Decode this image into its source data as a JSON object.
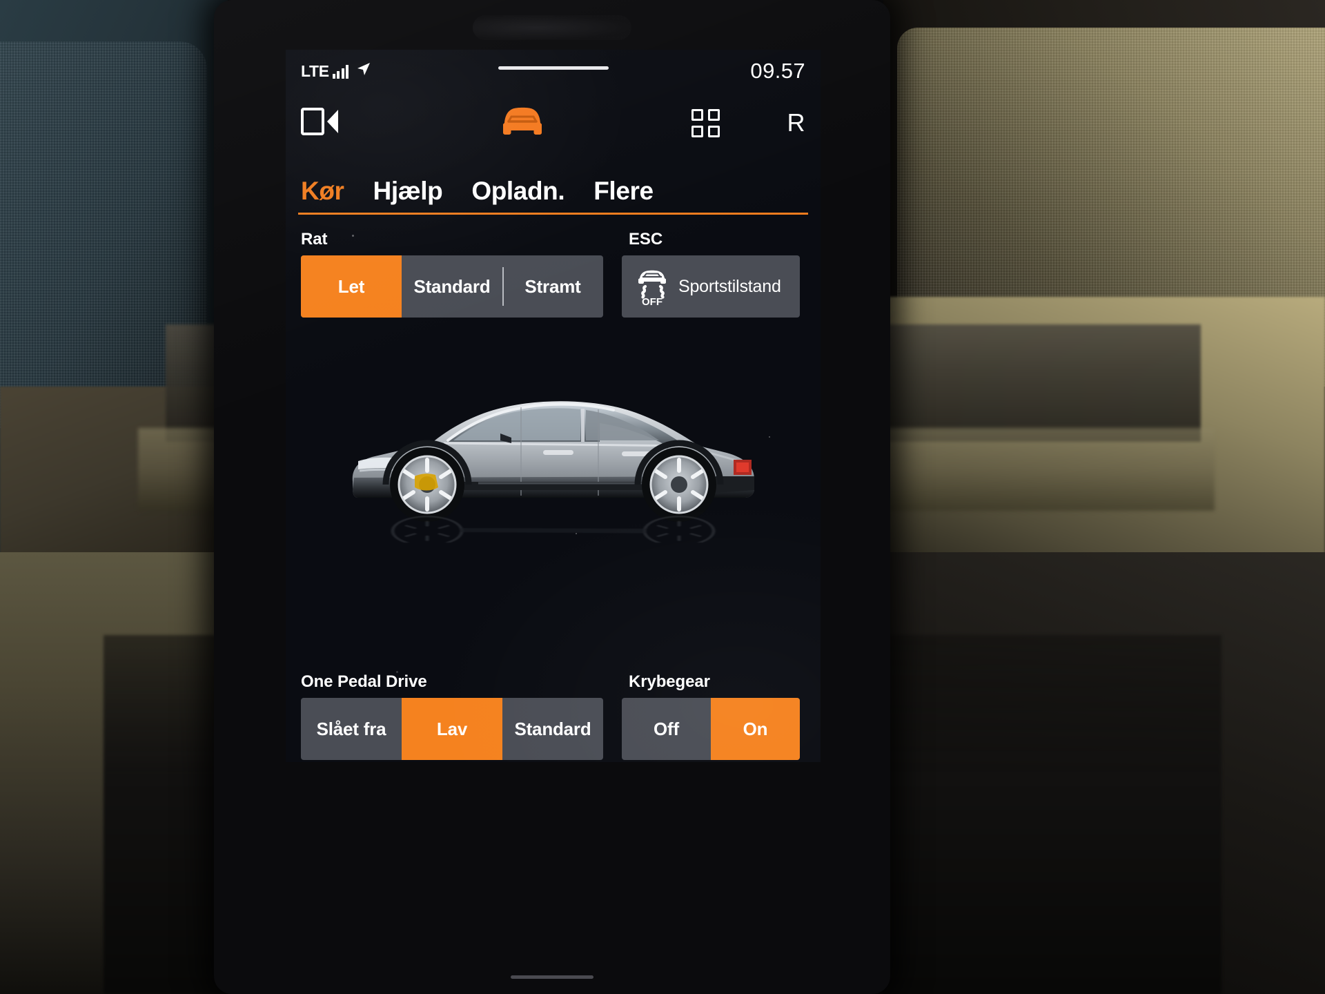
{
  "statusbar": {
    "network_label": "LTE",
    "signal_icon": "signal-bars-icon",
    "location_icon": "location-arrow-icon",
    "time": "09.57"
  },
  "iconrow": {
    "camera_icon": "camera-view-icon",
    "car_icon": "car-front-icon",
    "apps_icon": "apps-grid-icon",
    "gear_indicator": "R"
  },
  "tabs": [
    {
      "label": "Kør",
      "active": true
    },
    {
      "label": "Hjælp",
      "active": false
    },
    {
      "label": "Opladn.",
      "active": false
    },
    {
      "label": "Flere",
      "active": false
    }
  ],
  "steering": {
    "section_label": "Rat",
    "options": [
      "Let",
      "Standard",
      "Stramt"
    ],
    "selected": "Let"
  },
  "esc": {
    "section_label": "ESC",
    "icon": "esc-off-icon",
    "icon_caption": "OFF",
    "button_label": "Sportstilstand",
    "selected": false
  },
  "one_pedal_drive": {
    "section_label": "One Pedal Drive",
    "options": [
      "Slået fra",
      "Lav",
      "Standard"
    ],
    "selected": "Lav"
  },
  "creep": {
    "section_label": "Krybegear",
    "options": [
      "Off",
      "On"
    ],
    "selected": "On"
  },
  "vehicle_image": {
    "alt": "polestar-2-side-view",
    "body_color": "#9aa0a6",
    "caliper_color": "#d8a200"
  },
  "colors": {
    "accent": "#f5821f",
    "tab_active": "#f07c1e",
    "screen_bg": "#0a0c12",
    "control_bg": "#4a4d55",
    "text": "#ffffff"
  }
}
